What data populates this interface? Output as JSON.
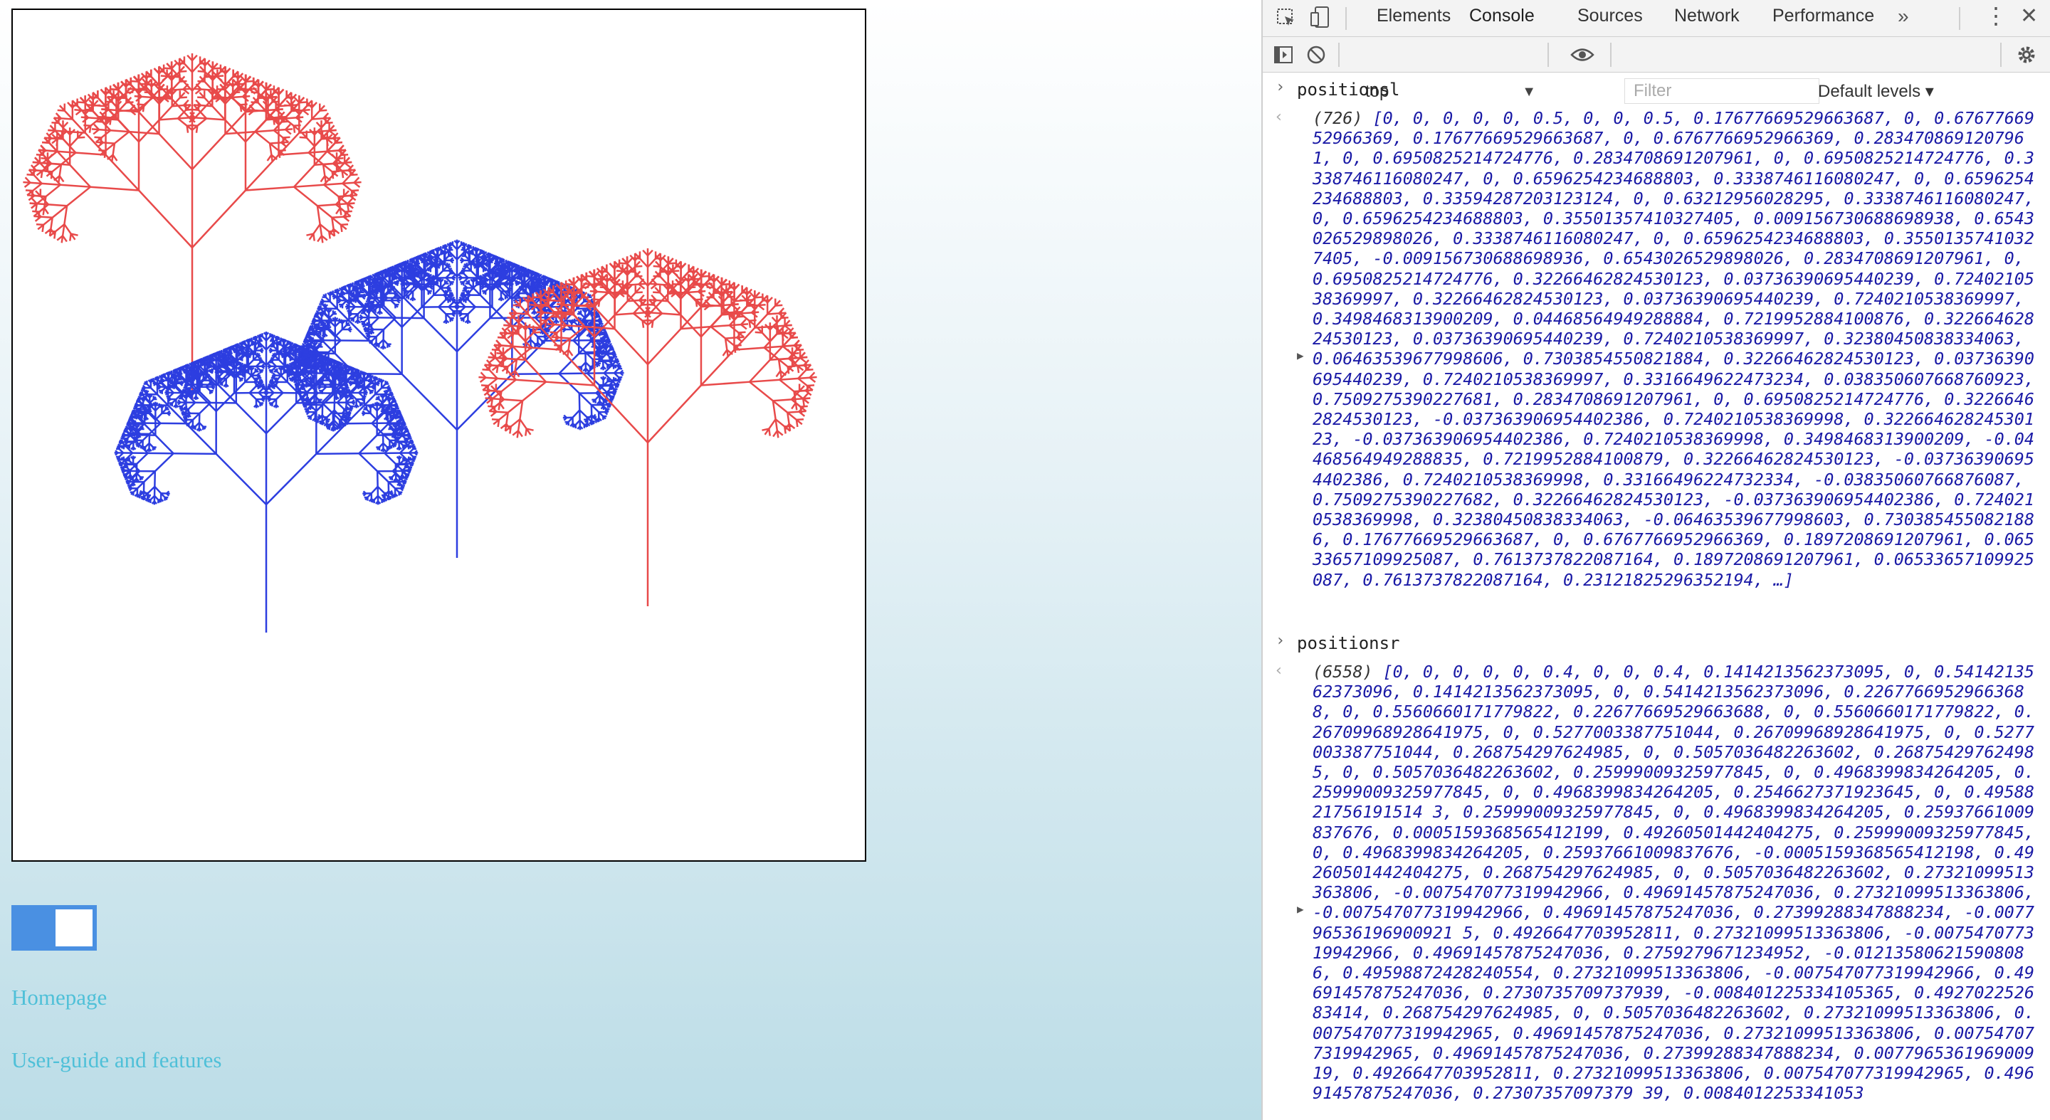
{
  "page": {
    "links": {
      "homepage": "Homepage",
      "user_guide": "User-guide and features"
    },
    "toggle": {
      "state": "on",
      "color": "#4a90e2"
    },
    "tree_colors": {
      "red": "#e84a4a",
      "blue": "#2d3ee0"
    }
  },
  "devtools": {
    "tabs": [
      "Elements",
      "Console",
      "Sources",
      "Network",
      "Performance"
    ],
    "active_tab": "Console",
    "more_tabs_icon": "double-chevron-right-icon",
    "context": "top",
    "filter_placeholder": "Filter",
    "levels": "Default levels ▾",
    "console": [
      {
        "command": "positionsl",
        "length": "(726)",
        "values": "[0, 0, 0, 0, 0, 0.5, 0, 0, 0.5, 0.17677669529663687, 0, 0.6767766952966369, 0.17677669529663687, 0, 0.6767766952966369, 0.2834708691207961, 0, 0.6950825214724776, 0.2834708691207961, 0, 0.6950825214724776, 0.3338746116080247, 0, 0.6596254234688803, 0.3338746116080247, 0, 0.6596254234688803, 0.33594287203123124, 0, 0.63212956028295, 0.3338746116080247, 0, 0.6596254234688803, 0.35501357410327405, 0.009156730688698938, 0.6543026529898026, 0.3338746116080247, 0, 0.6596254234688803, 0.35501357410327405, -0.009156730688698936, 0.6543026529898026, 0.2834708691207961, 0, 0.6950825214724776, 0.32266462824530123, 0.03736390695440239, 0.7240210538369997, 0.32266462824530123, 0.03736390695440239, 0.7240210538369997, 0.3498468313900209, 0.04468564949288884, 0.7219952884100876, 0.32266462824530123, 0.03736390695440239, 0.7240210538369997, 0.32380450838334063, 0.06463539677998606, 0.7303854550821884, 0.32266462824530123, 0.03736390695440239, 0.7240210538369997, 0.3316649622473234, 0.038350607668760923, 0.7509275390227681, 0.2834708691207961, 0, 0.6950825214724776, 0.32266462824530123, -0.037363906954402386, 0.7240210538369998, 0.32266462824530123, -0.037363906954402386, 0.7240210538369998, 0.3498468313900209, -0.04468564949288835, 0.7219952884100879, 0.32266462824530123, -0.037363906954402386, 0.7240210538369998, 0.33166496224732334, -0.03835060766876087, 0.7509275390227682, 0.32266462824530123, -0.037363906954402386, 0.7240210538369998, 0.32380450838334063, -0.06463539677998603, 0.7303854550821886, 0.17677669529663687, 0, 0.6767766952966369, 0.1897208691207961, 0.06533657109925087, 0.7613737822087164, 0.1897208691207961, 0.06533657109925087, 0.7613737822087164, 0.23121825296352194, …]"
      },
      {
        "command": "positionsr",
        "length": "(6558)",
        "values": "[0, 0, 0, 0, 0, 0.4, 0, 0, 0.4, 0.1414213562373095, 0, 0.5414213562373096, 0.1414213562373095, 0, 0.5414213562373096, 0.22677669529663688, 0, 0.5560660171779822, 0.22677669529663688, 0, 0.5560660171779822, 0.26709968928641975, 0, 0.5277003387751044, 0.26709968928641975, 0, 0.5277003387751044, 0.268754297624985, 0, 0.5057036482263602, 0.268754297624985, 0, 0.5057036482263602, 0.25999009325977845, 0, 0.4968399834264205, 0.25999009325977845, 0, 0.4968399834264205, 0.2546627371923645, 0, 0.4958821756191514 3, 0.25999009325977845, 0, 0.4968399834264205, 0.25937661009837676, 0.0005159368565412199, 0.49260501442404275, 0.25999009325977845, 0, 0.4968399834264205, 0.25937661009837676, -0.0005159368565412198, 0.49260501442404275, 0.268754297624985, 0, 0.5057036482263602, 0.27321099513363806, -0.007547077319942966, 0.49691457875247036, 0.27321099513363806, -0.007547077319942966, 0.49691457875247036, 0.27399288347888234, -0.007796536196900921 5, 0.4926647703952811, 0.27321099513363806, -0.007547077319942966, 0.49691457875247036, 0.2759279671234952, -0.012135806215908086, 0.49598872428240554, 0.27321099513363806, -0.007547077319942966, 0.49691457875247036, 0.2730735709737939, -0.008401225334105365, 0.492702252683414, 0.268754297624985, 0, 0.5057036482263602, 0.27321099513363806, 0.007547077319942965, 0.49691457875247036, 0.27321099513363806, 0.007547077319942965, 0.49691457875247036, 0.27399288347888234, 0.007796536196900919, 0.4926647703952811, 0.27321099513363806, 0.007547077319942965, 0.49691457875247036, 0.27307357097379 39, 0.0084012253341053"
      }
    ]
  }
}
